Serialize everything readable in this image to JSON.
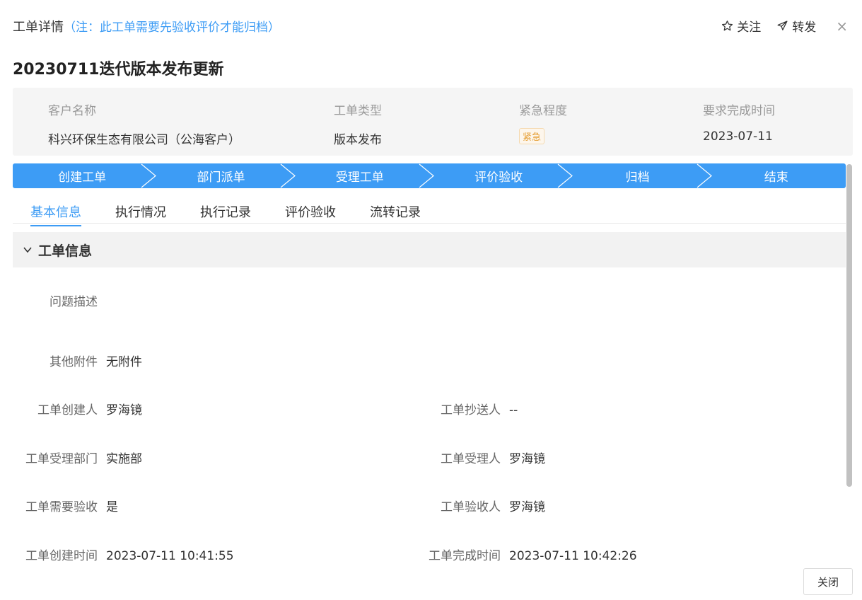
{
  "header": {
    "title": "工单详情",
    "note": "（注：此工单需要先验收评价才能归档）",
    "follow_label": "关注",
    "forward_label": "转发",
    "close_symbol": "×"
  },
  "order_title": "20230711迭代版本发布更新",
  "summary": {
    "customer_label": "客户名称",
    "customer_value": "科兴环保生态有限公司（公海客户）",
    "type_label": "工单类型",
    "type_value": "版本发布",
    "urgency_label": "紧急程度",
    "urgency_value": "紧急",
    "due_label": "要求完成时间",
    "due_value": "2023-07-11"
  },
  "steps": [
    "创建工单",
    "部门派单",
    "受理工单",
    "评价验收",
    "归档",
    "结束"
  ],
  "tabs": [
    "基本信息",
    "执行情况",
    "执行记录",
    "评价验收",
    "流转记录"
  ],
  "section": {
    "title": "工单信息"
  },
  "fields": {
    "problem_label": "问题描述",
    "problem_value": "",
    "attach_label": "其他附件",
    "attach_value": "无附件",
    "creator_label": "工单创建人",
    "creator_value": "罗海镜",
    "cc_label": "工单抄送人",
    "cc_value": "--",
    "dept_label": "工单受理部门",
    "dept_value": "实施部",
    "handler_label": "工单受理人",
    "handler_value": "罗海镜",
    "need_accept_label": "工单需要验收",
    "need_accept_value": "是",
    "acceptor_label": "工单验收人",
    "acceptor_value": "罗海镜",
    "created_time_label": "工单创建时间",
    "created_time_value": "2023-07-11 10:41:55",
    "finish_time_label": "工单完成时间",
    "finish_time_value": "2023-07-11 10:42:26"
  },
  "footer": {
    "close_label": "关闭"
  },
  "colors": {
    "accent": "#3d9cf5",
    "urgent": "#e6a23c"
  }
}
